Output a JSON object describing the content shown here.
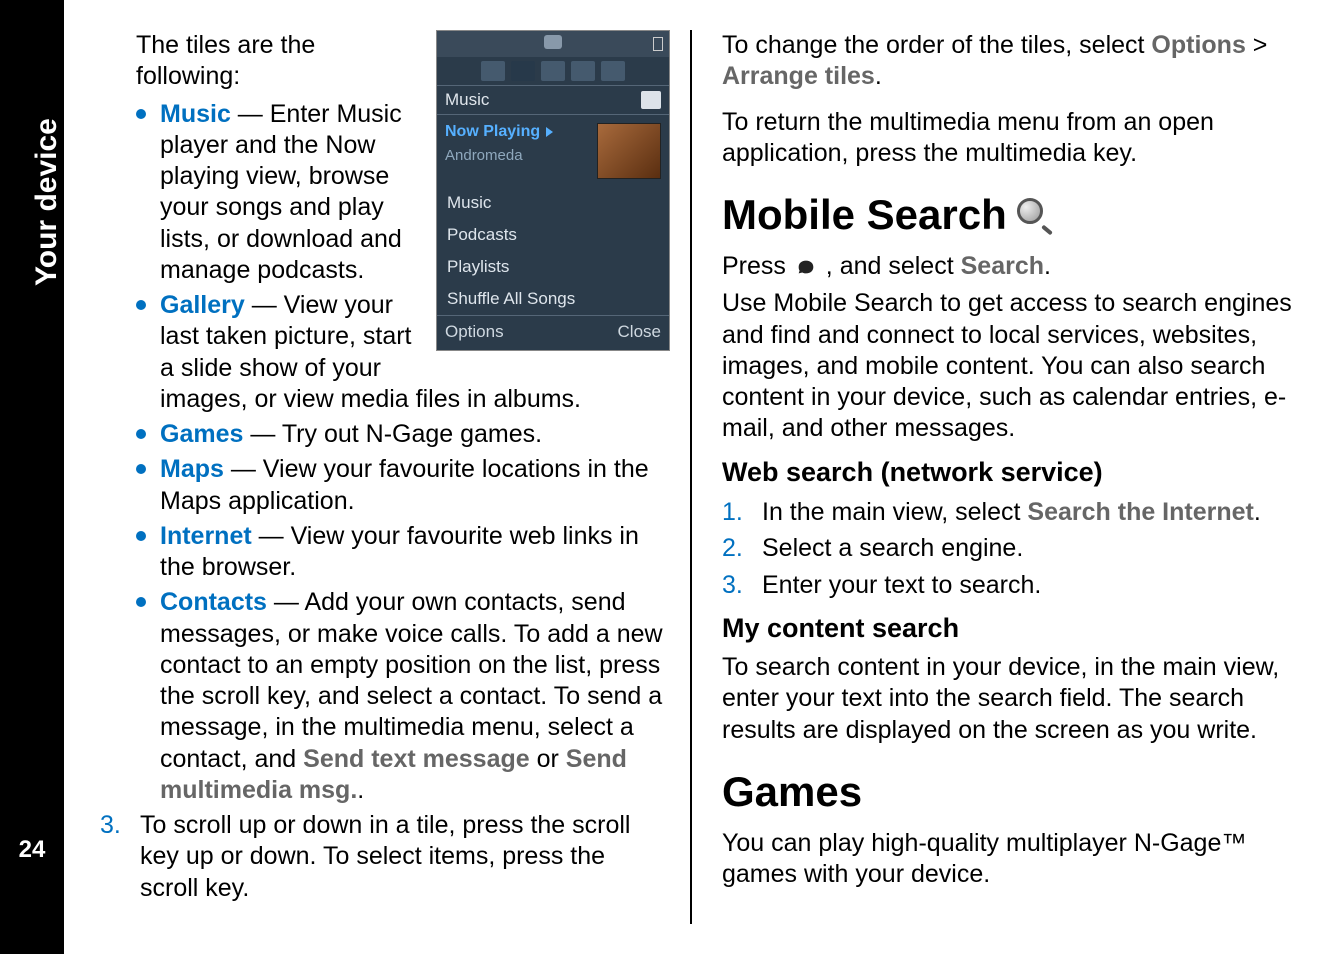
{
  "sidebar": {
    "section_title": "Your device",
    "page_number": "24"
  },
  "left": {
    "intro": "The tiles are the following:",
    "tiles": {
      "music": {
        "label": "Music",
        "desc": " — Enter Music player and the Now playing view, browse your songs and play lists, or download and manage podcasts."
      },
      "gallery": {
        "label": "Gallery",
        "desc": "  — View your last taken picture, start a slide show of your images, or view media files in albums."
      },
      "games": {
        "label": "Games",
        "desc": "  — Try out N-Gage games."
      },
      "maps": {
        "label": "Maps",
        "desc": "  — View your favourite locations in the Maps application."
      },
      "internet": {
        "label": "Internet",
        "desc": "  — View your favourite web links in the browser."
      },
      "contacts": {
        "label": "Contacts",
        "desc_a": "  — Add your own contacts, send messages, or make voice calls. To add a new contact to an empty position on the list, press the scroll key, and select a contact. To send a message, in the multimedia menu, select a contact, and ",
        "send_text": "Send text message",
        "or": " or ",
        "send_mms": "Send multimedia msg.",
        "period": "."
      }
    },
    "step3": "To scroll up or down in a tile, press the scroll key up or down. To select items, press the scroll key.",
    "figure": {
      "header": "Music",
      "now_playing": "Now Playing",
      "track": "Andromeda",
      "items": [
        "Music",
        "Podcasts",
        "Playlists",
        "Shuffle All Songs"
      ],
      "left_softkey": "Options",
      "right_softkey": "Close"
    }
  },
  "right": {
    "arrange_a": "To change the order of the tiles, select ",
    "options_label": "Options",
    "arrange_b": "  >  ",
    "arrange_tiles": "Arrange tiles",
    "arrange_c": ".",
    "return_para": "To return the multimedia menu from an open application, press the multimedia key.",
    "mobile_search_heading": "Mobile Search",
    "press_a": "Press  ",
    "press_b": " , and select ",
    "search_label": "Search",
    "press_c": ".",
    "ms_para": "Use Mobile Search to get access to search engines and find and connect to local services, websites, images, and mobile content. You can also search content in your device, such as calendar entries, e-mail, and other messages.",
    "web_search_heading": "Web search (network service)",
    "web_steps": {
      "s1a": "In the main view, select ",
      "s1b": "Search the Internet",
      "s1c": ".",
      "s2": "Select a search engine.",
      "s3": "Enter your text to search."
    },
    "my_content_heading": "My content search",
    "my_content_para": "To search content in your device, in the main view, enter your text into the search field. The search results are displayed on the screen as you write.",
    "games_heading": "Games",
    "games_para": "You can play high-quality multiplayer N-Gage™ games with your device."
  }
}
